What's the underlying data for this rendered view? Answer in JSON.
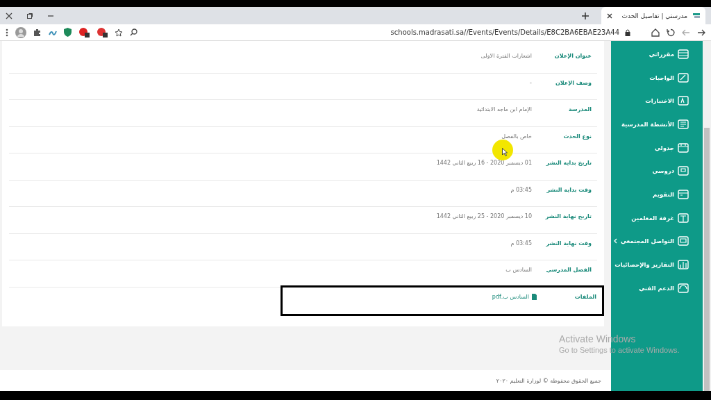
{
  "browser": {
    "tab_title": "مدرستي | تفاصيل الحدث",
    "url": "schools.madrasati.sa//Events/Events/Details/E8C2BA6EBAE23A44"
  },
  "details": {
    "rows": [
      {
        "label": "عنوان الإعلان",
        "value": "اشعارات الفترة الاولى",
        "kind": "text"
      },
      {
        "label": "وصف الإعلان",
        "value": "-",
        "kind": "text"
      },
      {
        "label": "المدرسة",
        "value": "الإمام ابن ماجه الابتدائية",
        "kind": "text"
      },
      {
        "label": "نوع الحدث",
        "value": "خاص بالفصل",
        "kind": "text"
      },
      {
        "label": "تاريخ بداية النشر",
        "value": "01 ديسمبر 2020 - 16 ربيع الثاني 1442",
        "kind": "text"
      },
      {
        "label": "وقت بداية النشر",
        "value": "03:45 م",
        "kind": "text"
      },
      {
        "label": "تاريخ نهاية النشر",
        "value": "10 ديسمبر 2020 - 25 ربيع الثاني 1442",
        "kind": "text"
      },
      {
        "label": "وقت نهاية النشر",
        "value": "03:45 م",
        "kind": "text"
      },
      {
        "label": "الفصل المدرسي",
        "value": "السادس ب",
        "kind": "text"
      },
      {
        "label": "الملفات",
        "value": "السادس ب.pdf",
        "kind": "file"
      }
    ]
  },
  "sidebar": {
    "items": [
      {
        "label": "مقرراتي",
        "has_submenu": false
      },
      {
        "label": "الواجبات",
        "has_submenu": false
      },
      {
        "label": "الاختبارات",
        "has_submenu": false
      },
      {
        "label": "الأنشطة المدرسية",
        "has_submenu": false
      },
      {
        "label": "جدولي",
        "has_submenu": false
      },
      {
        "label": "دروسي",
        "has_submenu": false
      },
      {
        "label": "التقويم",
        "has_submenu": false
      },
      {
        "label": "غرفة المعلمين",
        "has_submenu": false
      },
      {
        "label": "التواصل المجتمعي",
        "has_submenu": true
      },
      {
        "label": "التقارير والإحصائيات",
        "has_submenu": false
      },
      {
        "label": "الدعم الفني",
        "has_submenu": false
      }
    ]
  },
  "footer": {
    "text": "جميع الحقوق محفوظة © لوزارة التعليم ٢٠٢٠"
  },
  "windows_notice": {
    "title": "Activate Windows",
    "subtitle": "Go to Settings to activate Windows."
  }
}
